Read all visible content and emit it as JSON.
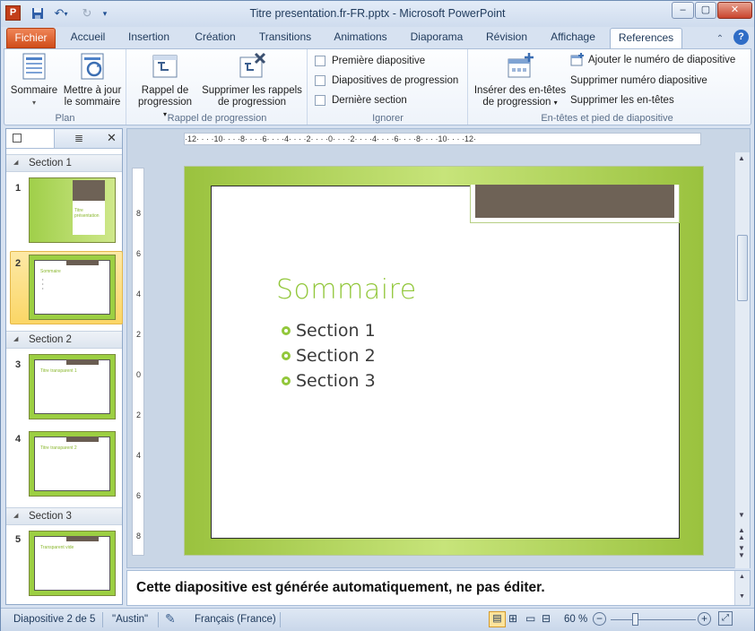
{
  "window": {
    "title": "Titre presentation.fr-FR.pptx  -  Microsoft PowerPoint",
    "app_letter": "P",
    "controls": {
      "minimize": "–",
      "maximize": "▢",
      "close": "✕"
    }
  },
  "tabs": [
    "Fichier",
    "Accueil",
    "Insertion",
    "Création",
    "Transitions",
    "Animations",
    "Diaporama",
    "Révision",
    "Affichage",
    "References"
  ],
  "active_tab": "References",
  "ribbon": {
    "plan": {
      "label": "Plan",
      "sommaire": "Sommaire",
      "update_line1": "Mettre à jour",
      "update_line2": "le sommaire"
    },
    "progress": {
      "label": "Rappel de progression",
      "rappel_line1": "Rappel de",
      "rappel_line2": "progression",
      "suppr_line1": "Supprimer les rappels",
      "suppr_line2": "de progression"
    },
    "ignore": {
      "label": "Ignorer",
      "items": [
        "Première diapositive",
        "Diapositives de progression",
        "Dernière section"
      ]
    },
    "headers": {
      "label": "En-têtes et pied de diapositive",
      "insert_line1": "Insérer des en-têtes",
      "insert_line2": "de progression",
      "add_number": "Ajouter le numéro de diapositive",
      "remove_number": "Supprimer numéro diapositive",
      "remove_headers": "Supprimer les en-têtes"
    }
  },
  "slides_pane": {
    "sections": [
      "Section 1",
      "Section 2",
      "Section 3"
    ],
    "slides": [
      {
        "num": "1",
        "text": "Titre présentation"
      },
      {
        "num": "2",
        "text": "Sommaire"
      },
      {
        "num": "3",
        "text": "Titre transparent 1"
      },
      {
        "num": "4",
        "text": "Titre transparent 2"
      },
      {
        "num": "5",
        "text": "Transparent vide"
      }
    ],
    "selected": "2"
  },
  "slide": {
    "title": "Sommaire",
    "bullets": [
      "Section 1",
      "Section 2",
      "Section 3"
    ]
  },
  "hruler_text": "·12· · · ·10· · · ·8· · · ·6· · · ·4· · · ·2· · · ·0· · · ·2· · · ·4· · · ·6· · · ·8· · · ·10· · · ·12·",
  "vruler_labels": [
    "8",
    "6",
    "4",
    "2",
    "0",
    "2",
    "4",
    "6",
    "8"
  ],
  "notes": "Cette diapositive est générée automatiquement, ne pas éditer.",
  "status": {
    "slide_info": "Diapositive 2 de 5",
    "theme": "\"Austin\"",
    "language": "Français (France)",
    "zoom": "60 %"
  },
  "colors": {
    "accent": "#92c73b",
    "file_tab": "#d04d19",
    "placeholder_tab": "#6e6256"
  }
}
